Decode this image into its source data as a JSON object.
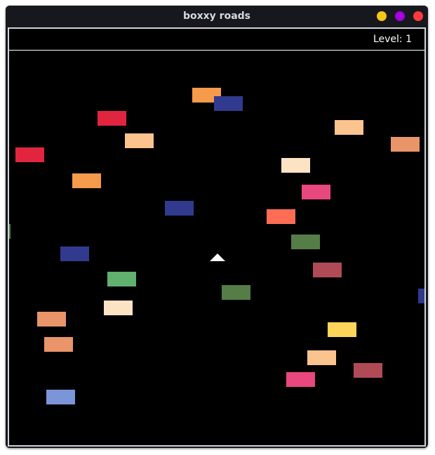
{
  "window": {
    "title": "boxxy roads",
    "controls": [
      "minimize",
      "maximize",
      "close"
    ],
    "control_colors": [
      "#f5c518",
      "#a400e0",
      "#ff3b3b"
    ]
  },
  "hud": {
    "level_text": "Level: 1"
  },
  "player": {
    "shape": "triangle",
    "color": "#ffffff"
  },
  "boxes_colors": [
    "#f69a4b",
    "#313a8f",
    "#e1253f",
    "#fbc38e",
    "#fbc38e",
    "#e99569",
    "#e1253f",
    "#fce3c4",
    "#f69a4b",
    "#e8487e",
    "#313a8f",
    "#fd6c53",
    "#567d47",
    "#313a8f",
    "#b04a56",
    "#60b06e",
    "#567d47",
    "#fce3c4",
    "#e99569",
    "#fed55a",
    "#e99569",
    "#fbc38e",
    "#b04a56",
    "#e8487e",
    "#7c95d8",
    "#567d47",
    "#313a8f"
  ]
}
